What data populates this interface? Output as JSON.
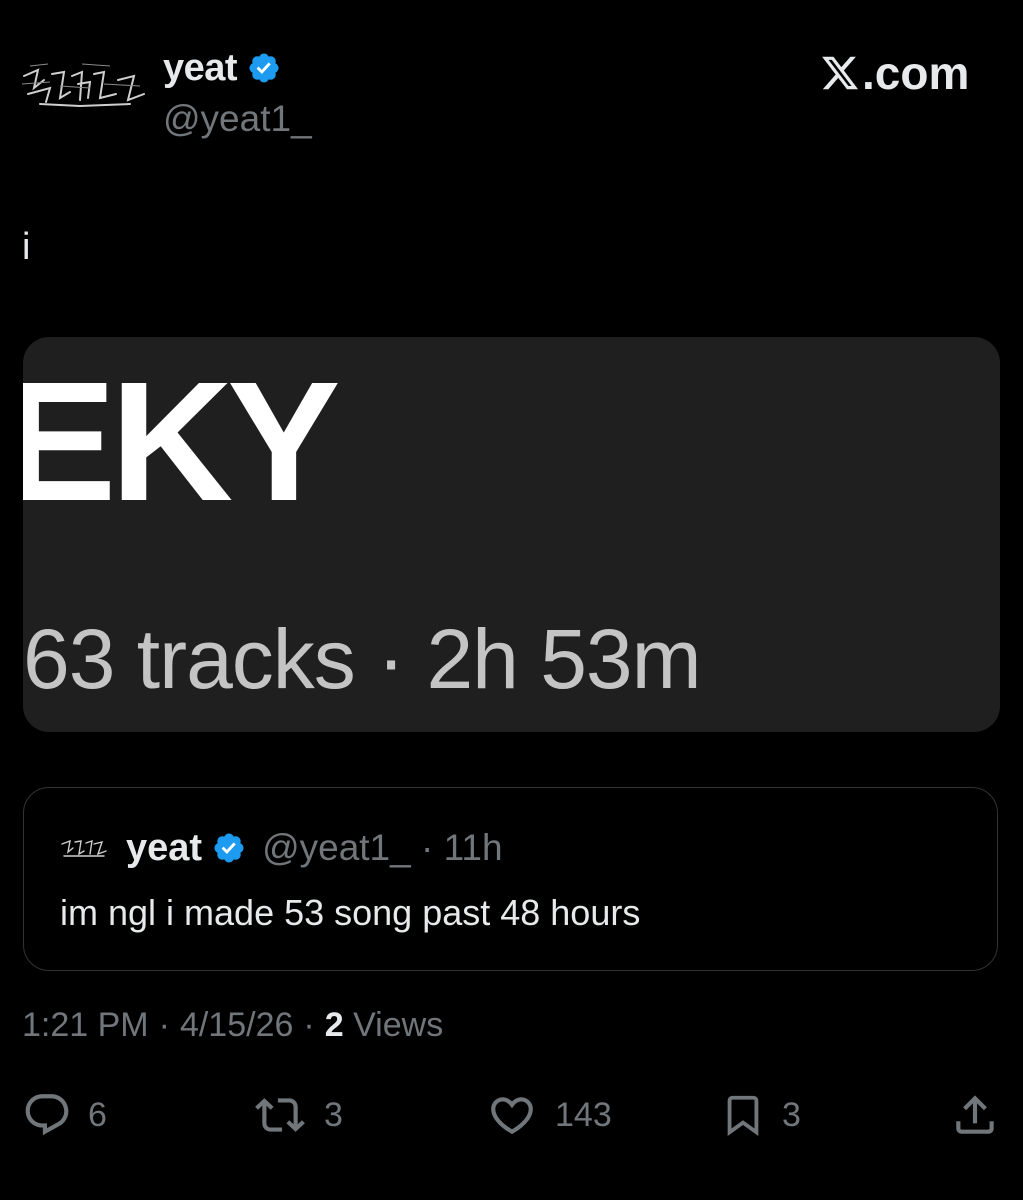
{
  "header": {
    "display_name": "yeat",
    "handle": "@yeat1_",
    "brand": ".com"
  },
  "tweet": {
    "text": "i",
    "media": {
      "title": "EKY",
      "subtitle": "63 tracks · 2h 53m"
    }
  },
  "quote": {
    "display_name": "yeat",
    "handle_time": "@yeat1_ · 11h",
    "text": "im ngl i made 53 song past 48 hours"
  },
  "meta": {
    "time": "1:21 PM",
    "date": "4/15/26",
    "views_count": "2",
    "views_label": "Views",
    "sep": "·"
  },
  "actions": {
    "replies": "6",
    "reposts": "3",
    "likes": "143",
    "bookmarks": "3"
  },
  "colors": {
    "background": "#000000",
    "text": "#e7e9ea",
    "muted": "#71767b",
    "verified": "#1d9bf0",
    "card": "#1f1f1f",
    "border": "#2f3336"
  },
  "icons": [
    "gothic-logo",
    "verified-badge-icon",
    "x-logo-icon",
    "reply-icon",
    "retweet-icon",
    "like-icon",
    "bookmark-icon",
    "share-icon"
  ]
}
